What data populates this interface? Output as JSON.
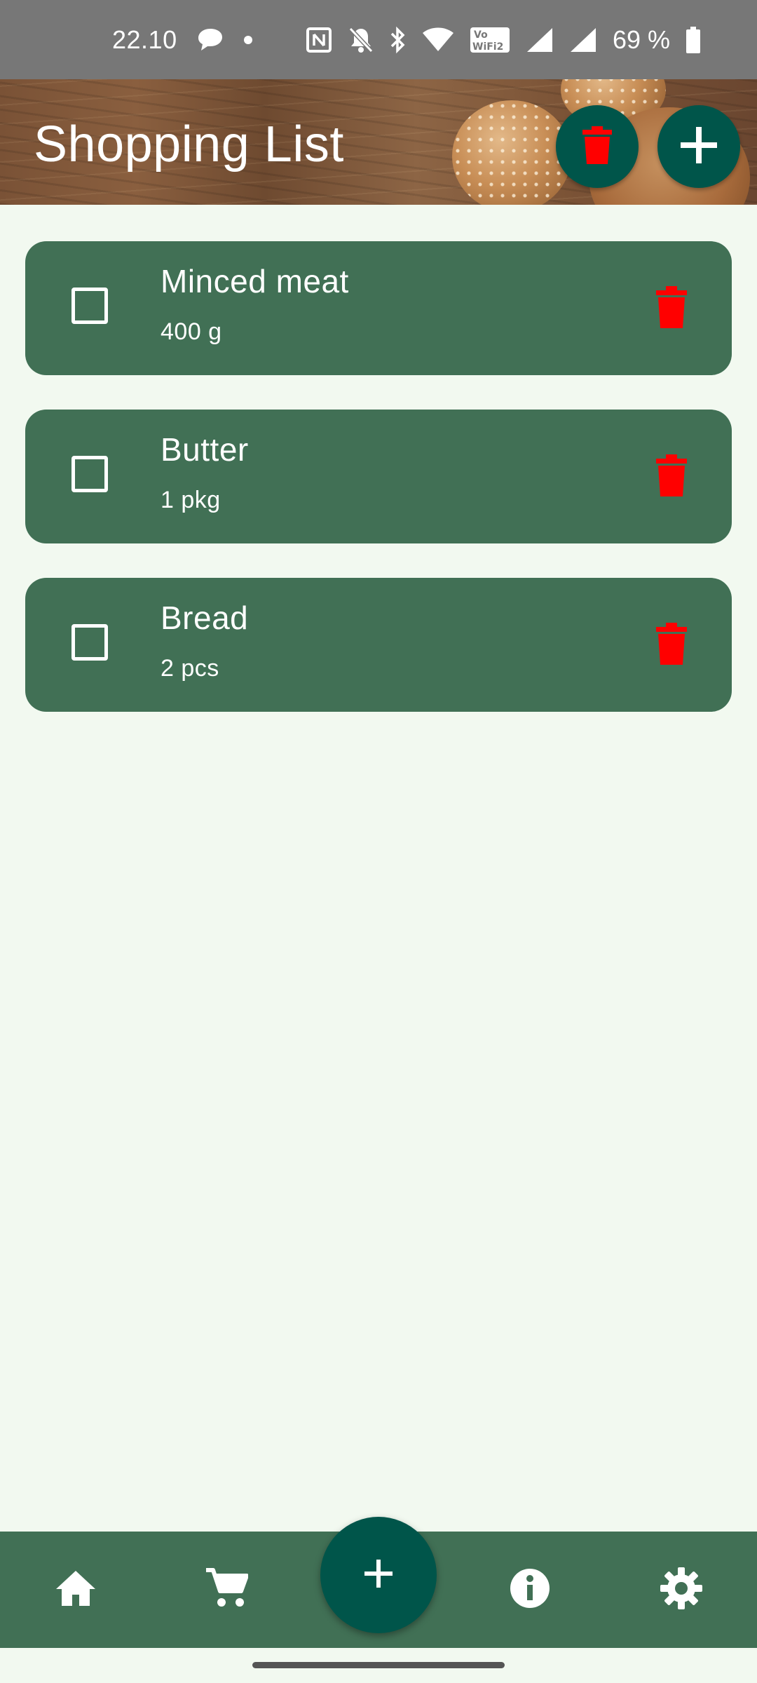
{
  "status_bar": {
    "time": "22.10",
    "battery_percent": "69 %",
    "icons": [
      "chat-bubble-icon",
      "dot-icon",
      "nfc-icon",
      "bell-off-icon",
      "bluetooth-icon",
      "wifi-icon",
      "vowifi-icon",
      "signal-icon",
      "signal-icon",
      "battery-icon"
    ]
  },
  "header": {
    "title": "Shopping List",
    "delete_all_icon": "trash-icon",
    "add_icon": "plus-icon"
  },
  "items": [
    {
      "name": "Minced meat",
      "quantity": "400 g",
      "checked": false
    },
    {
      "name": "Butter",
      "quantity": "1 pkg",
      "checked": false
    },
    {
      "name": "Bread",
      "quantity": "2 pcs",
      "checked": false
    }
  ],
  "bottom_nav": {
    "items": [
      "home-icon",
      "cart-icon",
      "info-icon",
      "settings-icon"
    ],
    "fab_icon": "plus-icon"
  },
  "colors": {
    "background": "#f2f9f0",
    "card": "#417055",
    "button": "#00554a",
    "delete": "#ff0000",
    "status_bar": "#777777"
  }
}
